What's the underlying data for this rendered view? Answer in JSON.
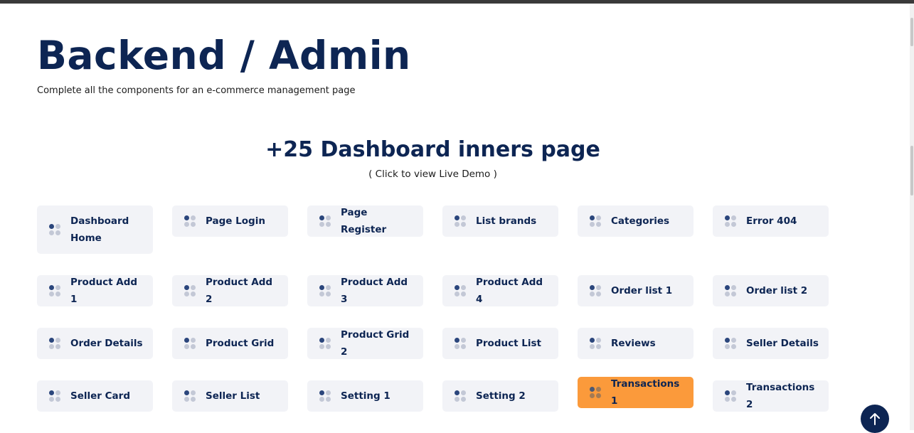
{
  "header": {
    "title": "Backend / Admin",
    "subtitle": "Complete all the components for an e-commerce management page"
  },
  "section": {
    "title": "+25 Dashboard inners page",
    "hint": "( Click to view Live Demo )"
  },
  "pages": [
    {
      "label": "Dashboard Home"
    },
    {
      "label": "Page Login"
    },
    {
      "label": "Page Register"
    },
    {
      "label": "List brands"
    },
    {
      "label": "Categories"
    },
    {
      "label": "Error 404"
    },
    {
      "label": "Product Add 1"
    },
    {
      "label": "Product Add 2"
    },
    {
      "label": "Product Add 3"
    },
    {
      "label": "Product Add 4"
    },
    {
      "label": "Order list 1"
    },
    {
      "label": "Order list 2"
    },
    {
      "label": "Order Details"
    },
    {
      "label": "Product Grid"
    },
    {
      "label": "Product Grid 2"
    },
    {
      "label": "Product List"
    },
    {
      "label": "Reviews"
    },
    {
      "label": "Seller Details"
    },
    {
      "label": "Seller Card"
    },
    {
      "label": "Seller List"
    },
    {
      "label": "Setting 1"
    },
    {
      "label": "Setting 2"
    },
    {
      "label": "Transactions 1",
      "state": "hovered"
    },
    {
      "label": "Transactions 2"
    }
  ],
  "back_to_top": {
    "icon": "arrow-up-icon"
  },
  "colors": {
    "navy": "#0d2553",
    "accent": "#fb9a3b",
    "card": "#f2f3f7"
  }
}
